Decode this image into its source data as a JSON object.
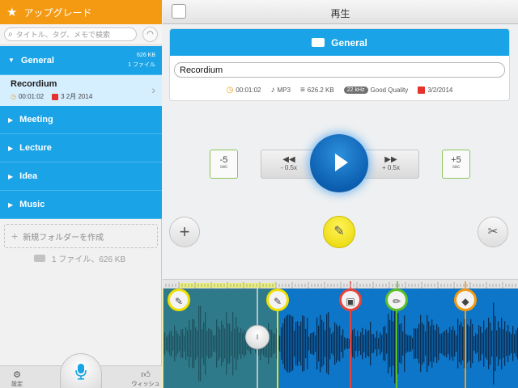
{
  "sidebar": {
    "upgrade_label": "アップグレード",
    "search_placeholder": "タイトル、タグ、メモで検索",
    "folders": [
      {
        "label": "General",
        "size": "626 KB",
        "count": "1 ファイル",
        "expanded": true
      },
      {
        "label": "Meeting"
      },
      {
        "label": "Lecture"
      },
      {
        "label": "Idea"
      },
      {
        "label": "Music"
      }
    ],
    "recording": {
      "title": "Recordium",
      "duration": "00:01:02",
      "date": "3 2月 2014"
    },
    "new_folder_label": "新規フォルダーを作成",
    "stats": "1 ファイル、626 KB",
    "settings_label": "設定",
    "wish_label": "ウィッシュ"
  },
  "topbar": {
    "title": "再生"
  },
  "detail": {
    "folder_name": "General",
    "recording_name": "Recordium",
    "duration": "00:01:02",
    "format": "MP3",
    "size": "626.2 KB",
    "sample_rate": "22 kHz",
    "quality": "Good Quality",
    "date": "3/2/2014"
  },
  "transport": {
    "skip_back": "-5",
    "skip_fwd": "+5",
    "skip_unit": "sec",
    "slow_label": "- 0.5x",
    "fast_label": "+ 0.5x"
  },
  "colors": {
    "accent_blue": "#1aa3e6",
    "upgrade_orange": "#f49a12",
    "marker_yellow": "#f0e000",
    "marker_red": "#e8443b",
    "marker_green": "#5cbf2a",
    "marker_orange": "#f49a12"
  },
  "icons": [
    "star-icon",
    "search-icon",
    "wifi-icon",
    "folder-icon",
    "clock-icon",
    "music-note-icon",
    "database-icon",
    "calendar-icon",
    "play-icon",
    "rewind-icon",
    "forward-icon",
    "plus-icon",
    "highlighter-icon",
    "scissors-icon",
    "microphone-icon",
    "gear-icon",
    "thumbs-up-icon",
    "image-icon",
    "pencil-icon",
    "tag-icon"
  ]
}
